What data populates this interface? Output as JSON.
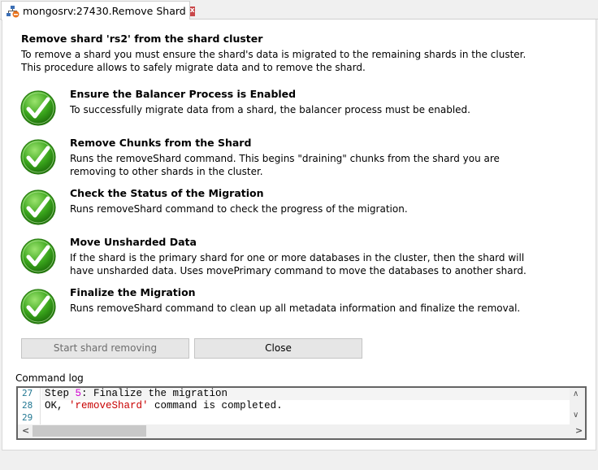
{
  "tab": {
    "title": "mongosrv:27430.Remove Shard",
    "icon": "sharding-icon",
    "close_glyph": "x"
  },
  "header": {
    "title": "Remove shard 'rs2' from the shard cluster",
    "description": "To remove a shard you must ensure the shard's data is migrated to the remaining shards in the cluster. This procedure allows to safely migrate data and to remove the shard."
  },
  "steps": [
    {
      "title": "Ensure the Balancer Process is Enabled",
      "description": "To successfully migrate data from a shard, the balancer process must be enabled.",
      "status": "completed"
    },
    {
      "title": "Remove Chunks from the Shard",
      "description": "Runs the removeShard command. This begins \"draining\" chunks from the shard you are removing to other shards in the cluster.",
      "status": "completed"
    },
    {
      "title": "Check the Status of the Migration",
      "description": "Runs removeShard command to check the progress of the migration.",
      "status": "completed"
    },
    {
      "title": "Move Unsharded Data",
      "description": "If the shard is the primary shard for one or more databases in the cluster, then the shard will have unsharded data. Uses movePrimary command to move the databases to another shard.",
      "status": "completed"
    },
    {
      "title": "Finalize the Migration",
      "description": "Runs removeShard command to clean up all metadata information and finalize the removal.",
      "status": "completed"
    }
  ],
  "buttons": {
    "start": "Start  shard removing",
    "close": "Close"
  },
  "log": {
    "label": "Command log",
    "lines": [
      {
        "number": "27",
        "parts": [
          {
            "text": "Step ",
            "type": "plain"
          },
          {
            "text": "5",
            "type": "num"
          },
          {
            "text": ": Finalize the migration",
            "type": "plain"
          }
        ]
      },
      {
        "number": "28",
        "parts": [
          {
            "text": "OK, ",
            "type": "plain"
          },
          {
            "text": "'removeShard'",
            "type": "str"
          },
          {
            "text": " command is completed.",
            "type": "plain"
          }
        ]
      },
      {
        "number": "29",
        "parts": []
      }
    ]
  },
  "colors": {
    "check_green": "#3aa51c",
    "close_red": "#c9474a",
    "log_number": "#d200d2",
    "log_string": "#c80000",
    "line_number": "#237893"
  }
}
